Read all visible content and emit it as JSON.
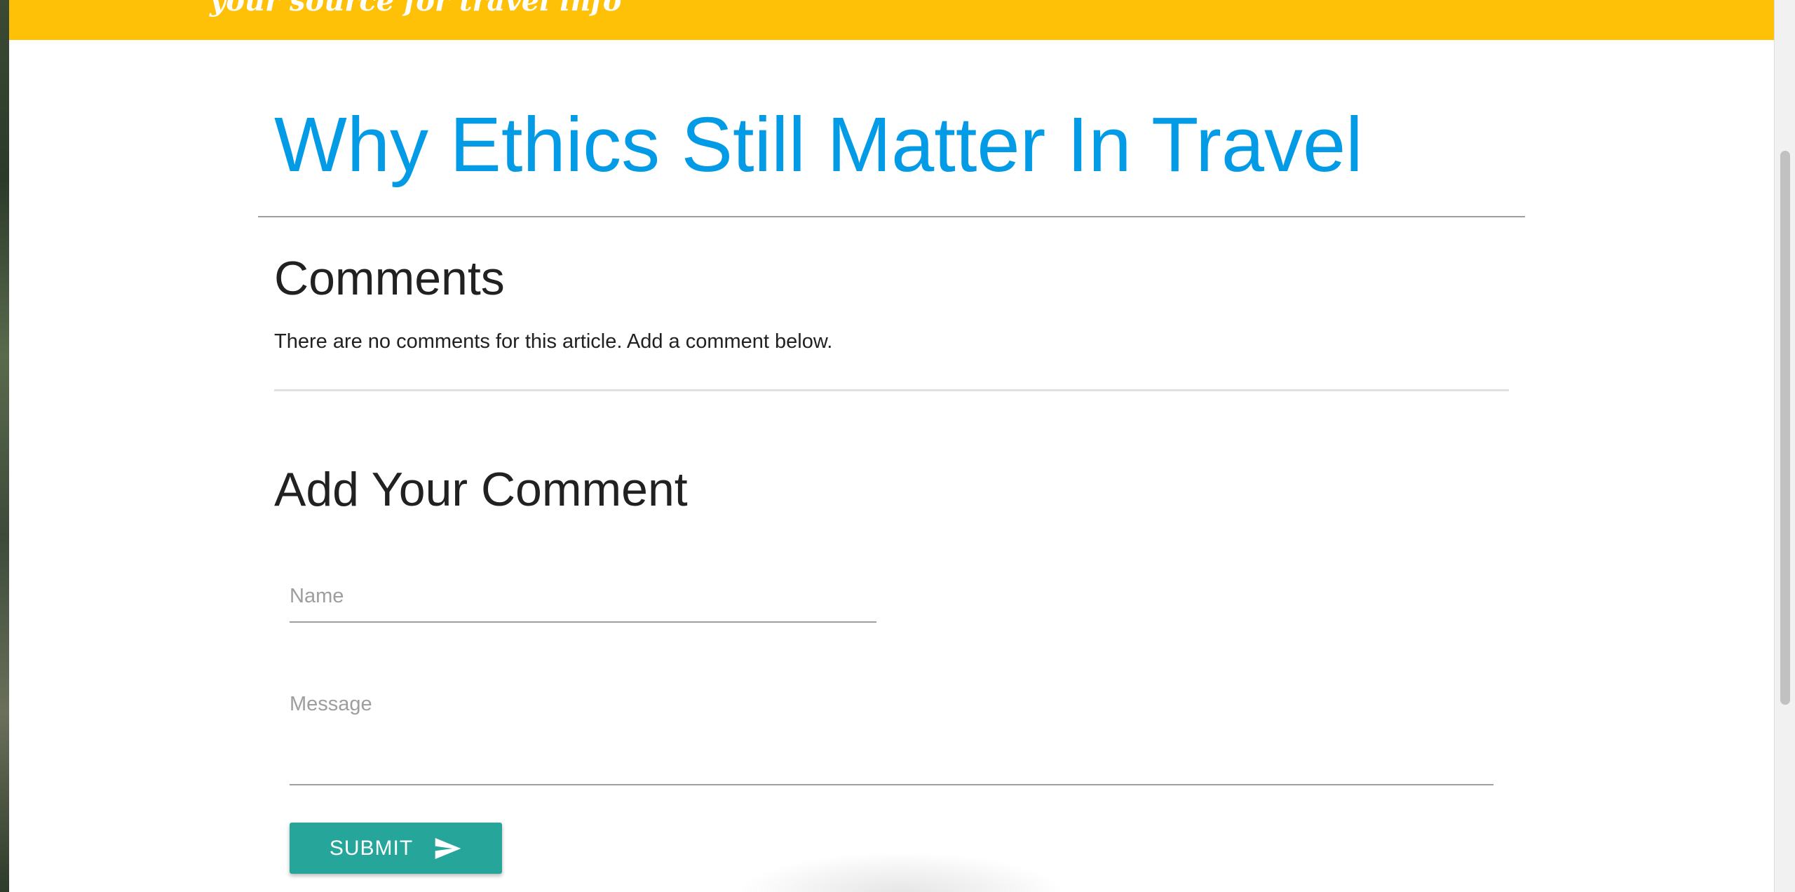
{
  "header": {
    "brand_text": "your source for travel info",
    "background_color": "#ffc107"
  },
  "article": {
    "title": "Why Ethics Still Matter In Travel",
    "title_color": "#039be5"
  },
  "comments": {
    "heading": "Comments",
    "empty_message": "There are no comments for this article. Add a comment below."
  },
  "comment_form": {
    "heading": "Add Your Comment",
    "name_placeholder": "Name",
    "name_value": "",
    "message_placeholder": "Message",
    "message_value": "",
    "submit_label": "SUBMIT",
    "submit_icon": "send-icon",
    "submit_color": "#26a69a"
  }
}
